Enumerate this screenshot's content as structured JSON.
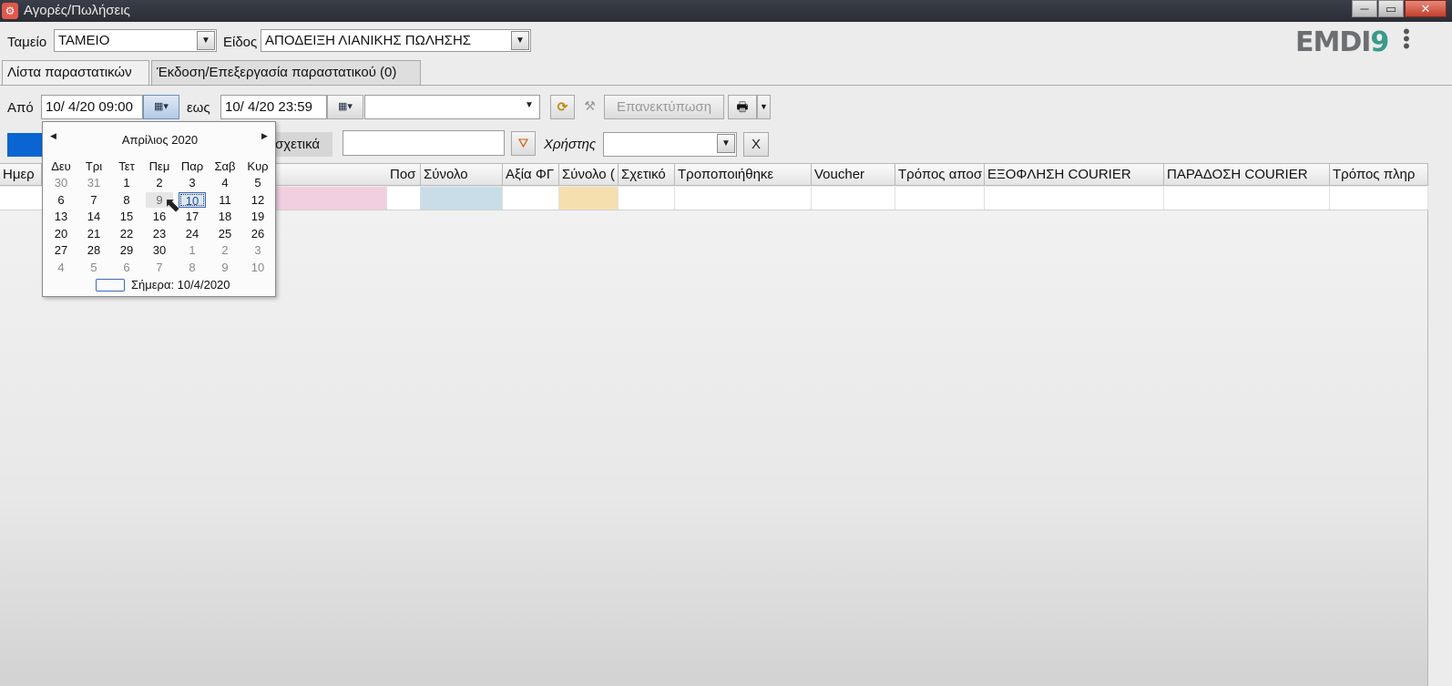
{
  "window": {
    "title": "Αγορές/Πωλήσεις",
    "controls": [
      "─",
      "▭",
      "✕"
    ]
  },
  "header": {
    "cashbox_label": "Ταμείο",
    "cashbox_value": "ΤΑΜΕΙΟ",
    "type_label": "Είδος",
    "type_value": "ΑΠΟΔΕΙΞΗ ΛΙΑΝΙΚΗΣ ΠΩΛΗΣΗΣ",
    "logo_text": "EMDI",
    "logo_num": "9"
  },
  "tabs": [
    {
      "label": "Λίστα παραστατικών",
      "active": true
    },
    {
      "label": "Έκδοση/Επεξεργασία παραστατικού (0)",
      "active": false
    }
  ],
  "filters": {
    "from_label": "Από",
    "from_value": "10/  4/20 09:00",
    "to_label": "εως",
    "to_value": "10/  4/20 23:59",
    "reprint_label": "Επανεκτύπωση",
    "related_label": "σχετικά",
    "user_label": "Χρήστης",
    "clear_label": "X"
  },
  "grid": {
    "columns": [
      "Ημερ",
      "Ποσ",
      "Σύνολο",
      "Αξία ΦΓ",
      "Σύνολο (",
      "Σχετικό",
      "Τροποποιήθηκε",
      "Voucher",
      "Τρόπος αποσ",
      "ΕΞΟΦΛΗΣΗ COURIER",
      "ΠΑΡΑΔΟΣΗ COURIER",
      "Τρόπος πληρ"
    ],
    "colors": {
      "pink": "#f2cfe0",
      "blue": "#c9dde8",
      "orange": "#f6dfae"
    }
  },
  "calendar": {
    "month_label": "Απρίλιος 2020",
    "weekdays": [
      "Δευ",
      "Τρι",
      "Τετ",
      "Πεμ",
      "Παρ",
      "Σαβ",
      "Κυρ"
    ],
    "weeks": [
      [
        "30",
        "31",
        "1",
        "2",
        "3",
        "4",
        "5"
      ],
      [
        "6",
        "7",
        "8",
        "9",
        "10",
        "11",
        "12"
      ],
      [
        "13",
        "14",
        "15",
        "16",
        "17",
        "18",
        "19"
      ],
      [
        "20",
        "21",
        "22",
        "23",
        "24",
        "25",
        "26"
      ],
      [
        "27",
        "28",
        "29",
        "30",
        "1",
        "2",
        "3"
      ],
      [
        "4",
        "5",
        "6",
        "7",
        "8",
        "9",
        "10"
      ]
    ],
    "today_label": "Σήμερα: 10/4/2020"
  }
}
